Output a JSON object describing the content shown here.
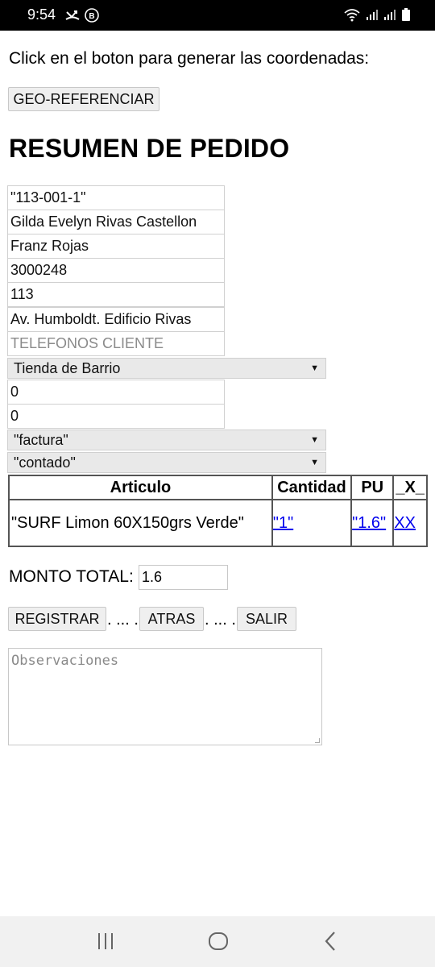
{
  "status_bar": {
    "time": "9:54",
    "icons": [
      "missed-call-icon",
      "b-badge-icon",
      "wifi-icon",
      "signal-icon",
      "signal-icon-2",
      "battery-icon"
    ]
  },
  "intro_text": "Click en el boton para generar las coordenadas:",
  "geo_button_label": "GEO-REFERENCIAR",
  "section_title": "RESUMEN DE PEDIDO",
  "fields": {
    "codigo": "\"113-001-1\"",
    "cliente": "Gilda Evelyn Rivas Castellon",
    "vendedor": "Franz Rojas",
    "numero": "3000248",
    "ruta": "113",
    "direccion": "Av. Humboldt. Edificio Rivas",
    "telefonos_placeholder": "TELEFONOS CLIENTE",
    "coord_1": "0",
    "coord_2": "0"
  },
  "selects": {
    "tipo_negocio": "Tienda de Barrio",
    "documento": "\"factura\"",
    "pago": "\"contado\""
  },
  "table": {
    "headers": [
      "Articulo",
      "Cantidad",
      "PU",
      "_X_"
    ],
    "rows": [
      {
        "articulo": "\"SURF Limon 60X150grs Verde\"",
        "cantidad": "\"1\"",
        "pu": "\"1.6\"",
        "x": "XX"
      }
    ]
  },
  "monto_total_label": "MONTO TOTAL:",
  "monto_total_value": "1.6",
  "buttons": {
    "registrar": "REGISTRAR",
    "atras": "ATRAS",
    "salir": "SALIR",
    "separator": ". ... ."
  },
  "observaciones_placeholder": "Observaciones",
  "nav": [
    "recent-apps-icon",
    "home-icon",
    "back-icon"
  ]
}
